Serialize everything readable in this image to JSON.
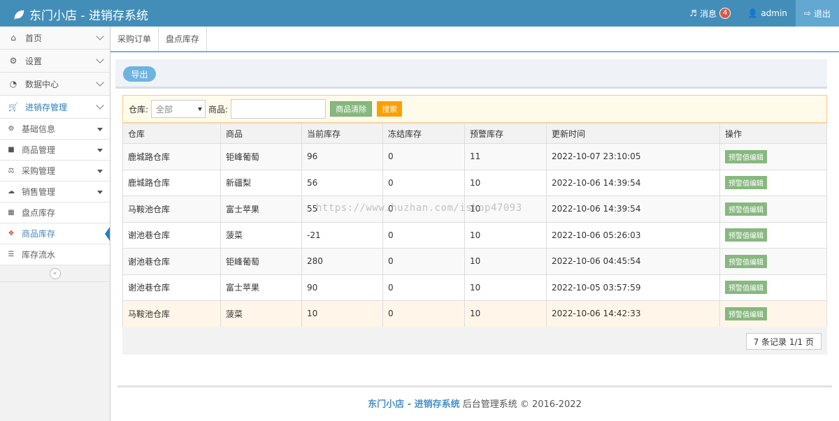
{
  "header": {
    "brand": "东门小店 - 进销存系统",
    "messages_label": "消息",
    "messages_count": "4",
    "user": "admin",
    "logout": "退出"
  },
  "sidebar": {
    "items": [
      {
        "label": "首页",
        "icon": "home-icon"
      },
      {
        "label": "设置",
        "icon": "gear-icon"
      },
      {
        "label": "数据中心",
        "icon": "pie-chart-icon"
      },
      {
        "label": "进销存管理",
        "icon": "cart-icon"
      }
    ],
    "sub": [
      {
        "label": "基础信息",
        "icon": "cogs-icon"
      },
      {
        "label": "商品管理",
        "icon": "bag-icon"
      },
      {
        "label": "采购管理",
        "icon": "scale-icon"
      },
      {
        "label": "销售管理",
        "icon": "cloud-icon"
      },
      {
        "label": "盘点库存",
        "icon": "grid-icon"
      },
      {
        "label": "商品库存",
        "icon": "cubes-icon"
      },
      {
        "label": "库存流水",
        "icon": "list-icon"
      }
    ],
    "collapse": "«"
  },
  "tabs": [
    "采购订单",
    "盘点库存"
  ],
  "toolbar": {
    "export": "导出"
  },
  "filter": {
    "warehouse_label": "仓库:",
    "warehouse_value": "全部",
    "product_label": "商品:",
    "product_value": "",
    "clear_btn": "商品清除",
    "search_btn": "搜索"
  },
  "table": {
    "headers": [
      "仓库",
      "商品",
      "当前库存",
      "冻结库存",
      "预警库存",
      "更新时间",
      "操作"
    ],
    "action": "预警值编辑",
    "rows": [
      [
        "鹿城路仓库",
        "钜峰葡萄",
        "96",
        "0",
        "11",
        "2022-10-07 23:10:05"
      ],
      [
        "鹿城路仓库",
        "新疆梨",
        "56",
        "0",
        "10",
        "2022-10-06 14:39:54"
      ],
      [
        "马鞍池仓库",
        "富士苹果",
        "55",
        "0",
        "10",
        "2022-10-06 14:39:54"
      ],
      [
        "谢池巷仓库",
        "菠菜",
        "-21",
        "0",
        "10",
        "2022-10-06 05:26:03"
      ],
      [
        "谢池巷仓库",
        "钜峰葡萄",
        "280",
        "0",
        "10",
        "2022-10-06 04:45:54"
      ],
      [
        "谢池巷仓库",
        "富士苹果",
        "90",
        "0",
        "10",
        "2022-10-05 03:57:59"
      ],
      [
        "马鞍池仓库",
        "菠菜",
        "10",
        "0",
        "10",
        "2022-10-06 14:42:33"
      ]
    ]
  },
  "pager": "7 条记录 1/1 页",
  "watermark": "https://www.huzhan.com/ishop47093",
  "footer": {
    "brand": "东门小店 - 进销存系统",
    "text": " 后台管理系统 © 2016-2022"
  },
  "colors": {
    "topbar": "#438eb9",
    "accent": "#6fb3e0",
    "green": "#87b87f",
    "orange": "#ff9e00"
  }
}
